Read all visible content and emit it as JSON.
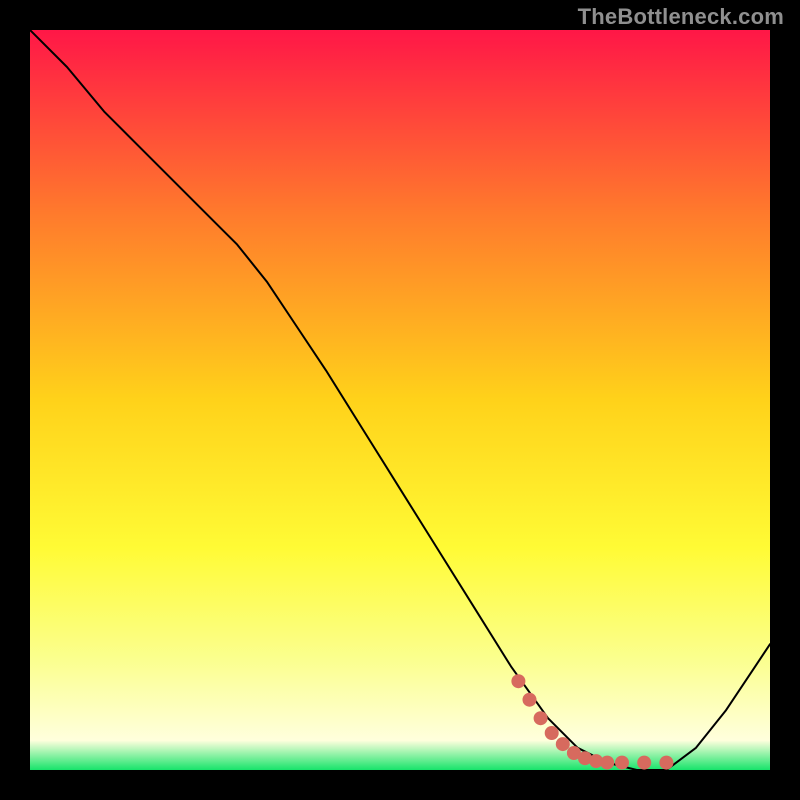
{
  "watermark": "TheBottleneck.com",
  "chart_data": {
    "type": "line",
    "title": "",
    "xlabel": "",
    "ylabel": "",
    "xlim": [
      0,
      100
    ],
    "ylim": [
      0,
      100
    ],
    "grid": false,
    "legend": false,
    "background_gradient": {
      "stops": [
        {
          "offset": 0.0,
          "color": "#ff1747"
        },
        {
          "offset": 0.25,
          "color": "#ff7b2c"
        },
        {
          "offset": 0.5,
          "color": "#ffd21a"
        },
        {
          "offset": 0.7,
          "color": "#fffb35"
        },
        {
          "offset": 0.85,
          "color": "#fbff8e"
        },
        {
          "offset": 0.96,
          "color": "#ffffdd"
        },
        {
          "offset": 1.0,
          "color": "#17e46b"
        }
      ]
    },
    "series": [
      {
        "name": "bottleneck-curve",
        "color": "#000000",
        "stroke_width": 2,
        "x": [
          0,
          5,
          10,
          15,
          20,
          25,
          28,
          32,
          36,
          40,
          45,
          50,
          55,
          60,
          65,
          70,
          74,
          78,
          82,
          86,
          90,
          94,
          98,
          100
        ],
        "y": [
          100,
          95,
          89,
          84,
          79,
          74,
          71,
          66,
          60,
          54,
          46,
          38,
          30,
          22,
          14,
          7,
          3,
          1,
          0,
          0,
          3,
          8,
          14,
          17
        ]
      }
    ],
    "highlight": {
      "name": "recommended-zone",
      "color": "#d76a5e",
      "dot_radius": 7,
      "points": [
        {
          "x": 66,
          "y": 12
        },
        {
          "x": 67.5,
          "y": 9.5
        },
        {
          "x": 69,
          "y": 7
        },
        {
          "x": 70.5,
          "y": 5
        },
        {
          "x": 72,
          "y": 3.5
        },
        {
          "x": 73.5,
          "y": 2.3
        },
        {
          "x": 75,
          "y": 1.6
        },
        {
          "x": 76.5,
          "y": 1.2
        },
        {
          "x": 78,
          "y": 1.0
        },
        {
          "x": 80,
          "y": 1.0
        },
        {
          "x": 83,
          "y": 1.0
        },
        {
          "x": 86,
          "y": 1.0
        }
      ]
    }
  }
}
